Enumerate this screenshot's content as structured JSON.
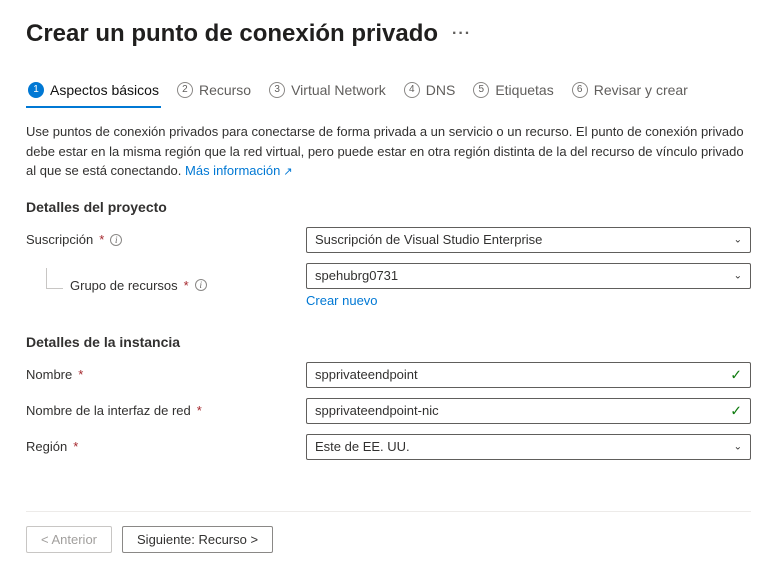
{
  "title": "Crear un punto de conexión privado",
  "tabs": [
    {
      "num": "1",
      "label": "Aspectos básicos",
      "active": true
    },
    {
      "num": "2",
      "label": "Recurso"
    },
    {
      "num": "3",
      "label": "Virtual Network"
    },
    {
      "num": "4",
      "label": "DNS"
    },
    {
      "num": "5",
      "label": "Etiquetas"
    },
    {
      "num": "6",
      "label": "Revisar y crear"
    }
  ],
  "intro": "Use puntos de conexión privados para conectarse de forma privada a un servicio o un recurso. El punto de conexión privado debe estar en la misma región que la red virtual, pero puede estar en otra región distinta de la del recurso de vínculo privado al que se está conectando.",
  "learnMore": "Más información",
  "sections": {
    "projectTitle": "Detalles del proyecto",
    "subscriptionLabel": "Suscripción",
    "subscriptionValue": "Suscripción de Visual Studio Enterprise",
    "resourceGroupLabel": "Grupo de recursos",
    "resourceGroupValue": "spehubrg0731",
    "createNew": "Crear nuevo",
    "instanceTitle": "Detalles de la instancia",
    "nameLabel": "Nombre",
    "nameValue": "spprivateendpoint",
    "nicLabel": "Nombre de la interfaz de red",
    "nicValue": "spprivateendpoint-nic",
    "regionLabel": "Región",
    "regionValue": "Este de EE. UU."
  },
  "footer": {
    "prev": "< Anterior",
    "next": "Siguiente: Recurso >"
  }
}
